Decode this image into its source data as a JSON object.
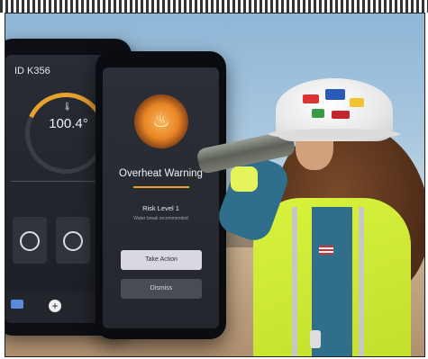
{
  "back_phone": {
    "device_id": "ID K356",
    "temperature": "100.4°",
    "icon": "thermometer-icon"
  },
  "front_phone": {
    "alert_icon": "flame-icon",
    "title": "Overheat Warning",
    "risk_level": "Risk Level 1",
    "note": "Water break recommended",
    "primary_action": "Take Action",
    "secondary_action": "Dismiss"
  },
  "colors": {
    "accent": "#e3a13a",
    "vest": "#d8f23e",
    "shirt": "#2f6f8c"
  }
}
